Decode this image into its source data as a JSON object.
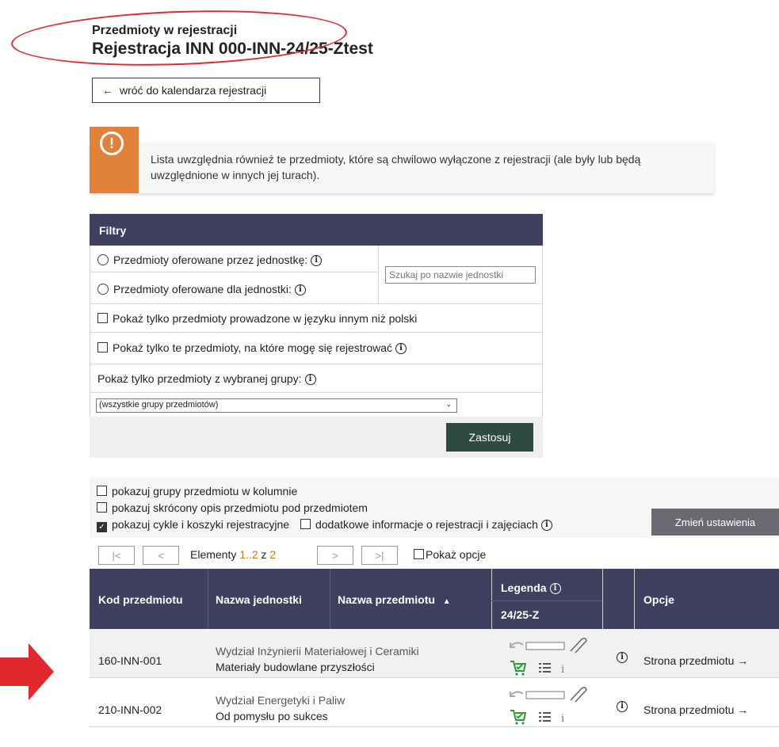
{
  "header": {
    "subtitle": "Przedmioty w rejestracji",
    "title": "Rejestracja INN 000-INN-24/25-Ztest"
  },
  "back_button": {
    "arrow": "←",
    "label": "wróć do kalendarza rejestracji"
  },
  "notice": {
    "icon": "!",
    "text": "Lista uwzględnia również te przedmioty, które są chwilowo wyłączone z rejestracji (ale były lub będą uwzględnione w innych jej turach)."
  },
  "filters": {
    "header": "Filtry",
    "offered_by": "Przedmioty oferowane przez jednostkę:",
    "offered_for": "Przedmioty oferowane dla jednostki:",
    "unit_search_placeholder": "Szukaj po nazwie jednostki",
    "non_polish": "Pokaż tylko przedmioty prowadzone w języku innym niż polski",
    "can_register": "Pokaż tylko te przedmioty, na które mogę się rejestrować",
    "group_label": "Pokaż tylko przedmioty z wybranej grupy:",
    "group_selected": "(wszystkie grupy przedmiotów)",
    "apply": "Zastosuj"
  },
  "settings": {
    "opt1": "pokazuj grupy przedmiotu w kolumnie",
    "opt2": "pokazuj skrócony opis przedmiotu pod przedmiotem",
    "opt3": "pokazuj cykle i koszyki rejestracyjne",
    "opt4": "dodatkowe informacje o rejestracji i zajęciach",
    "change_button": "Zmień ustawienia"
  },
  "pager": {
    "first": "|<",
    "prev": "<",
    "label": "Elementy",
    "range": "1..2",
    "of": "z",
    "total": "2",
    "next": ">",
    "last": ">|",
    "show_options": "Pokaż opcje"
  },
  "table": {
    "headers": {
      "code": "Kod przedmiotu",
      "unit": "Nazwa jednostki",
      "name": "Nazwa przedmiotu",
      "sort": "▲",
      "legend": "Legenda",
      "cycle": "24/25-Z",
      "options": "Opcje"
    },
    "rows": [
      {
        "code": "160-INN-001",
        "unit": "Wydział Inżynierii Materiałowej i Ceramiki",
        "name": "Materiały budowlane przyszłości",
        "link": "Strona przedmiotu",
        "link_arrow": "→"
      },
      {
        "code": "210-INN-002",
        "unit": "Wydział Energetyki i Paliw",
        "name": "Od pomysłu po sukces",
        "link": "Strona przedmiotu",
        "link_arrow": "→"
      }
    ]
  },
  "icons": {
    "info": "info-circle-icon",
    "cart": "cart-icon",
    "list": "list-icon",
    "clip": "paperclip-icon",
    "undo": "undo-icon"
  },
  "colors": {
    "header_bg": "#3f3f5f",
    "notice_icon": "#e0823a",
    "apply_btn": "#2f4a40",
    "cart_green": "#2e9a35",
    "annotation_red": "#e0282e"
  }
}
